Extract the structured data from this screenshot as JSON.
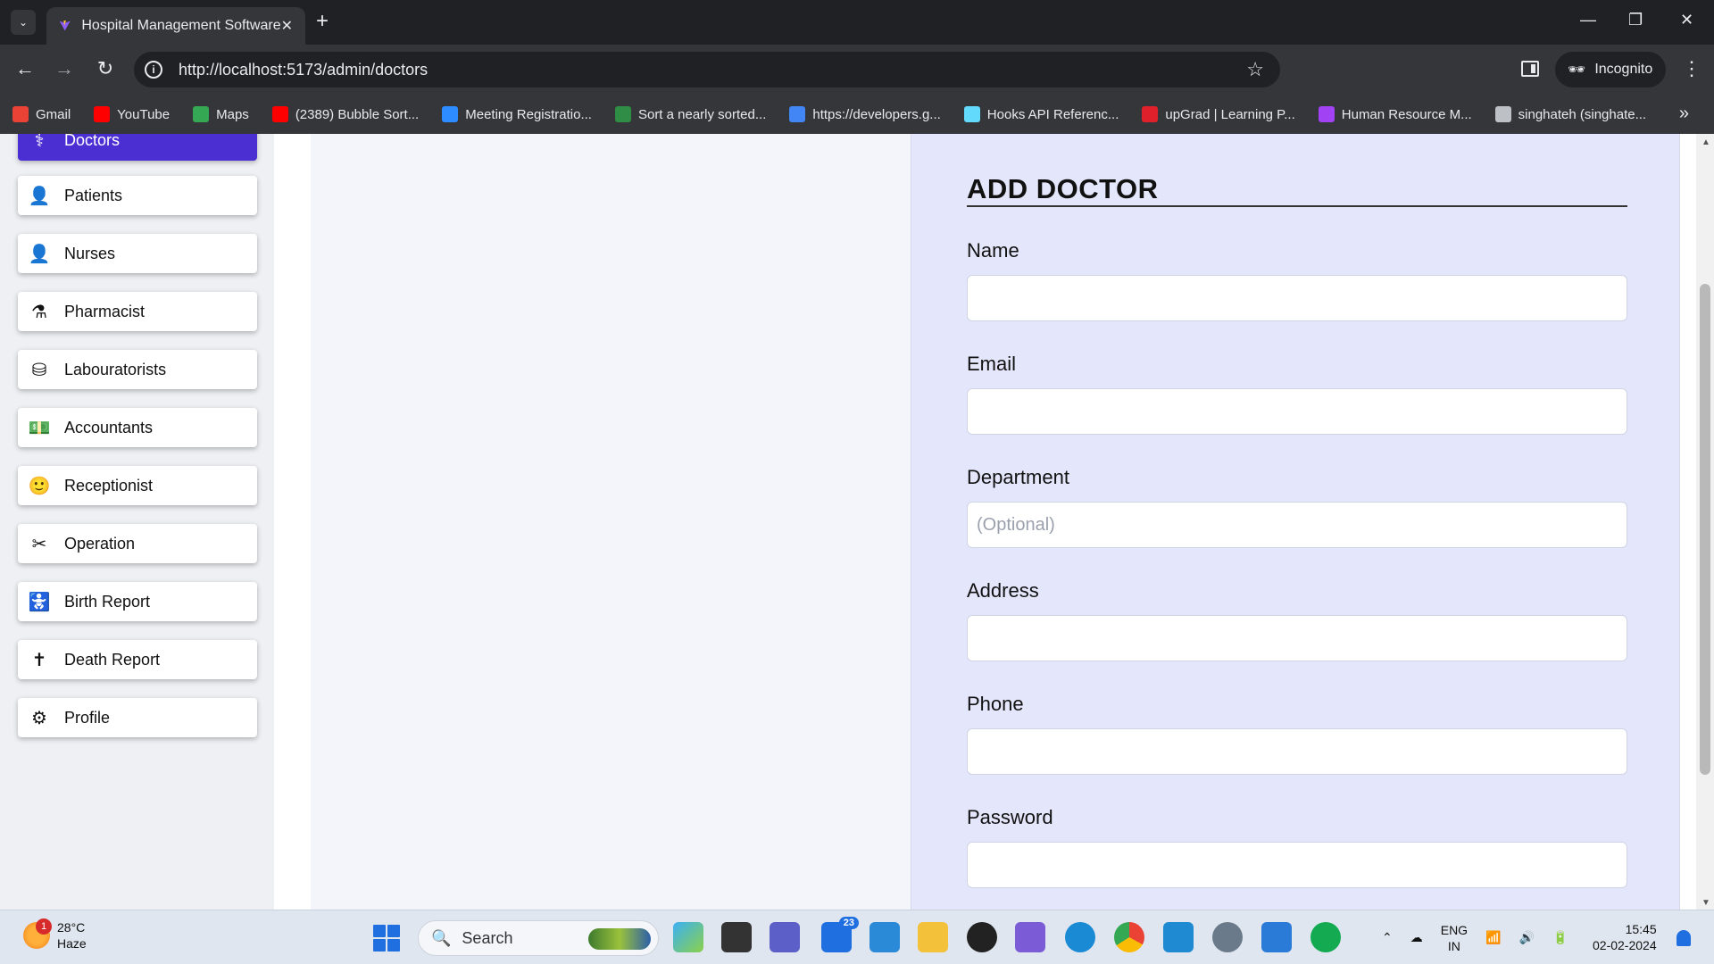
{
  "browser": {
    "tab_title": "Hospital Management Software",
    "url": "http://localhost:5173/admin/doctors",
    "incognito_label": "Incognito",
    "bookmarks": [
      {
        "label": "Gmail",
        "icon": "gmail-icon",
        "color": "#ea4335"
      },
      {
        "label": "YouTube",
        "icon": "youtube-icon",
        "color": "#ff0000"
      },
      {
        "label": "Maps",
        "icon": "maps-icon",
        "color": "#34a853"
      },
      {
        "label": "(2389) Bubble Sort...",
        "icon": "youtube-icon",
        "color": "#ff0000"
      },
      {
        "label": "Meeting Registratio...",
        "icon": "zoom-icon",
        "color": "#2d8cff"
      },
      {
        "label": "Sort a nearly sorted...",
        "icon": "gfg-icon",
        "color": "#2f8d46"
      },
      {
        "label": "https://developers.g...",
        "icon": "google-icon",
        "color": "#4285f4"
      },
      {
        "label": "Hooks API Referenc...",
        "icon": "react-icon",
        "color": "#61dafb"
      },
      {
        "label": "upGrad | Learning P...",
        "icon": "upgrad-icon",
        "color": "#e0202a"
      },
      {
        "label": "Human Resource M...",
        "icon": "link-icon",
        "color": "#a142f4"
      },
      {
        "label": "singhateh (singhate...",
        "icon": "github-icon",
        "color": "#bdc1c6"
      }
    ]
  },
  "sidebar": {
    "items": [
      {
        "label": "Doctors",
        "icon": "doctor-icon",
        "glyph": "⚕",
        "active": true
      },
      {
        "label": "Patients",
        "icon": "patient-icon",
        "glyph": "👤"
      },
      {
        "label": "Nurses",
        "icon": "nurse-icon",
        "glyph": "👤"
      },
      {
        "label": "Pharmacist",
        "icon": "pharmacist-icon",
        "glyph": "⚗"
      },
      {
        "label": "Labouratorists",
        "icon": "database-icon",
        "glyph": "⛁"
      },
      {
        "label": "Accountants",
        "icon": "money-icon",
        "glyph": "💵"
      },
      {
        "label": "Receptionist",
        "icon": "receptionist-icon",
        "glyph": "🙂"
      },
      {
        "label": "Operation",
        "icon": "operation-icon",
        "glyph": "✂"
      },
      {
        "label": "Birth Report",
        "icon": "baby-icon",
        "glyph": "🚼"
      },
      {
        "label": "Death Report",
        "icon": "cross-icon",
        "glyph": "✝"
      },
      {
        "label": "Profile",
        "icon": "gear-icon",
        "glyph": "⚙"
      }
    ]
  },
  "form": {
    "title": "ADD DOCTOR",
    "fields": [
      {
        "label": "Name",
        "value": "",
        "placeholder": ""
      },
      {
        "label": "Email",
        "value": "",
        "placeholder": ""
      },
      {
        "label": "Department",
        "value": "",
        "placeholder": "(Optional)"
      },
      {
        "label": "Address",
        "value": "",
        "placeholder": ""
      },
      {
        "label": "Phone",
        "value": "",
        "placeholder": ""
      },
      {
        "label": "Password",
        "value": "",
        "placeholder": ""
      }
    ]
  },
  "taskbar": {
    "weather_temp": "28°C",
    "weather_desc": "Haze",
    "weather_badge": "1",
    "search_label": "Search",
    "mail_badge": "23",
    "lang_line1": "ENG",
    "lang_line2": "IN",
    "time": "15:45",
    "date": "02-02-2024"
  }
}
